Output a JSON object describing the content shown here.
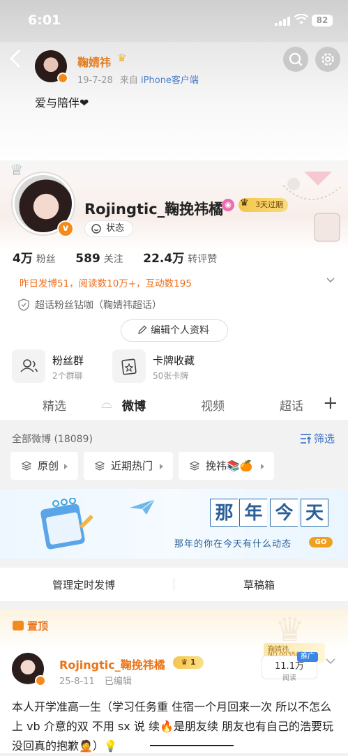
{
  "status_bar": {
    "time": "6:01",
    "battery": "82"
  },
  "header": {
    "name": "鞠婧祎",
    "date": "19-7-28",
    "source_prefix": "来自",
    "source": "iPhone客户端",
    "post_text": "爱与陪伴❤"
  },
  "profile": {
    "username": "Rojingtic_鞠挽祎橘",
    "vip_badge": "3天过期",
    "status_label": "状态",
    "stats": {
      "fans_num": "4万",
      "fans_label": "粉丝",
      "follow_num": "589",
      "follow_label": "关注",
      "likes_num": "22.4万",
      "likes_label": "转评赞"
    },
    "daily": "昨日发博51，阅读数10万+，互动数195",
    "fan_title": "超话粉丝钻咖（鞠婧祎超话）",
    "edit_button": "编辑个人资料",
    "fans_group": {
      "title": "粉丝群",
      "sub": "2个群聊"
    },
    "cards": {
      "title": "卡牌收藏",
      "sub": "50张卡牌"
    }
  },
  "tabs": [
    "精选",
    "微博",
    "视频",
    "超话"
  ],
  "filter": {
    "all": "全部微博 (18089)",
    "filter_label": "筛选",
    "chips": [
      "原创",
      "近期热门",
      "挽祎📚🍊"
    ]
  },
  "banner": {
    "chars": [
      "那",
      "年",
      "今",
      "天"
    ],
    "subtitle": "那年的你在今天有什么动态",
    "go": "GO"
  },
  "actions": {
    "scheduled": "管理定时发博",
    "drafts": "草稿箱"
  },
  "post": {
    "pin_label": "置顶",
    "user": "Rojingtic_鞠挽祎橘",
    "badge": "1",
    "date": "25-8-11",
    "edited": "已编辑",
    "card_name": "鞠婧祎",
    "card_no": "NO.003847",
    "promo": "推广",
    "reads_num": "11.1万",
    "reads_label": "阅读",
    "body": "本人开学准高一生（学习任务重 住宿一个月回来一次 所以不怎么上 vb 介意的双 不用 sx 说 续🔥是朋友续 朋友也有自己的浩要玩没回真的抱歉🤦）💡"
  },
  "colors": {
    "accent": "#e8751a",
    "link": "#3a70c4",
    "brand_orange": "#f38a1a"
  }
}
